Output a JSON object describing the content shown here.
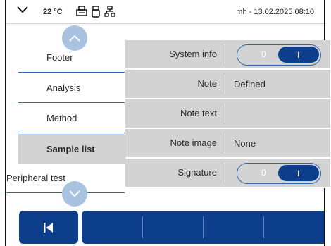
{
  "status_bar": {
    "temperature": "22 °C",
    "user_date": "mh - 13.02.2025 08:10",
    "icons": [
      "chevron-down-icon",
      "printer-icon",
      "usb-icon",
      "network-icon"
    ]
  },
  "nav": {
    "items": [
      {
        "label": "Footer"
      },
      {
        "label": "Analysis"
      },
      {
        "label": "Method"
      },
      {
        "label": "Sample list",
        "active": true
      },
      {
        "label": "Peripheral test"
      }
    ]
  },
  "settings": {
    "rows": [
      {
        "label": "System info",
        "type": "toggle",
        "off_label": "0",
        "on_label": "I",
        "state": "on"
      },
      {
        "label": "Note",
        "value": "Defined"
      },
      {
        "label": "Note text",
        "value": ""
      },
      {
        "label": "Note image",
        "value": "None"
      },
      {
        "label": "Signature",
        "type": "toggle",
        "off_label": "0",
        "on_label": "I",
        "state": "on"
      }
    ]
  },
  "toolbar": {
    "back_icon": "skip-back-icon"
  },
  "colors": {
    "primary": "#0d3e8c",
    "scroll_button": "#a9c2e0",
    "row_bg": "#d3d3d3",
    "divider": "#2f66ad"
  }
}
